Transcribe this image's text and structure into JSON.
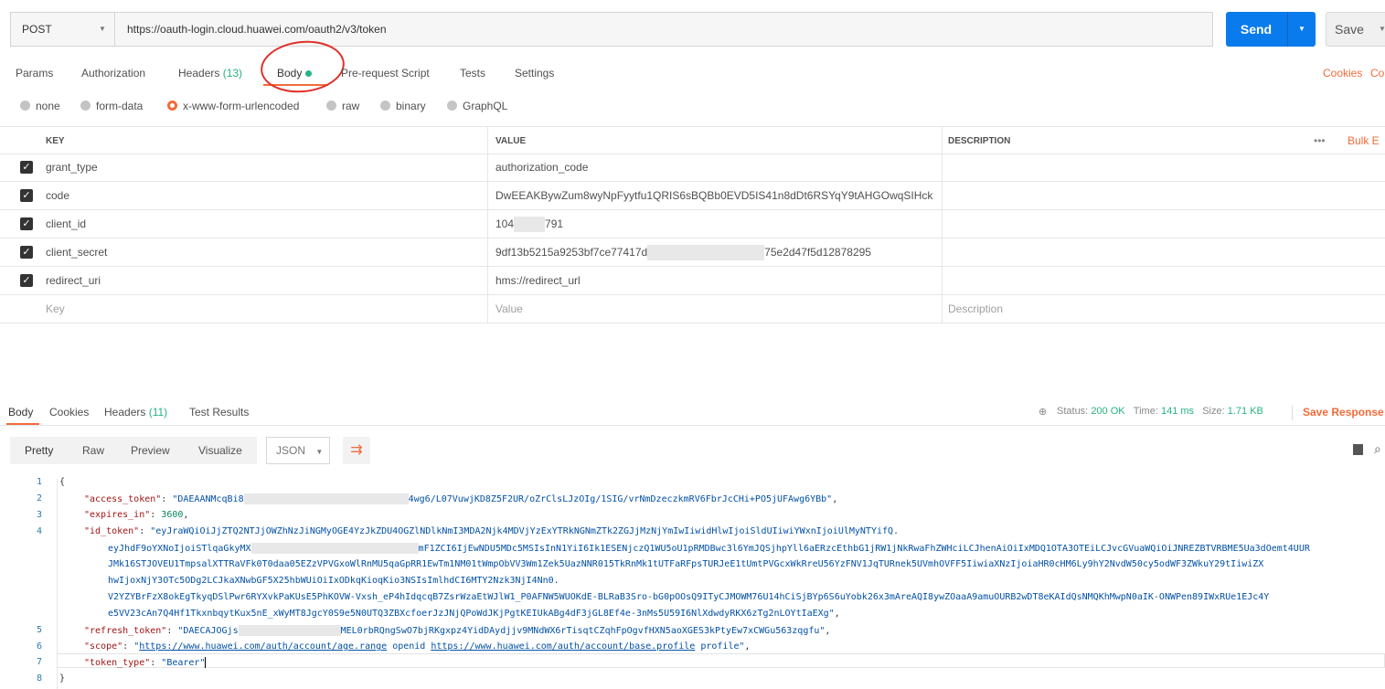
{
  "request": {
    "method": "POST",
    "url": "https://oauth-login.cloud.huawei.com/oauth2/v3/token",
    "send_label": "Send",
    "save_label": "Save"
  },
  "tabs": {
    "params": "Params",
    "authorization": "Authorization",
    "headers": "Headers",
    "headers_count": "(13)",
    "body": "Body",
    "prerequest": "Pre-request Script",
    "tests": "Tests",
    "settings": "Settings",
    "cookies": "Cookies",
    "code": "Co"
  },
  "body_types": {
    "none": "none",
    "form_data": "form-data",
    "urlencoded": "x-www-form-urlencoded",
    "raw": "raw",
    "binary": "binary",
    "graphql": "GraphQL",
    "selected": "x-www-form-urlencoded"
  },
  "params_table": {
    "headers": {
      "key": "KEY",
      "value": "VALUE",
      "description": "DESCRIPTION",
      "more": "•••",
      "bulk": "Bulk E"
    },
    "rows": [
      {
        "key": "grant_type",
        "value": "authorization_code",
        "checked": true
      },
      {
        "key": "code",
        "value": "DwEEAKBywZum8wyNpFyytfu1QRIS6sBQBb0EVD5IS41n8dDt6RSYqY9tAHGOwqSIHck",
        "checked": true
      },
      {
        "key": "client_id",
        "value_a": "104",
        "value_b": "791",
        "checked": true
      },
      {
        "key": "client_secret",
        "value_a": "9df13b5215a9253bf7ce77417d",
        "value_b": "75e2d47f5d12878295",
        "checked": true
      },
      {
        "key": "redirect_uri",
        "value": "hms://redirect_url",
        "checked": true
      }
    ],
    "placeholder": {
      "key": "Key",
      "value": "Value",
      "description": "Description"
    }
  },
  "response": {
    "tabs": {
      "body": "Body",
      "cookies": "Cookies",
      "headers": "Headers",
      "headers_count": "(11)",
      "test_results": "Test Results"
    },
    "status_label": "Status:",
    "status": "200 OK",
    "time_label": "Time:",
    "time": "141 ms",
    "size_label": "Size:",
    "size": "1.71 KB",
    "save_response": "Save Response",
    "view_modes": {
      "pretty": "Pretty",
      "raw": "Raw",
      "preview": "Preview",
      "visualize": "Visualize",
      "format": "JSON"
    }
  },
  "code": {
    "line_numbers": [
      "1",
      "2",
      "3",
      "4",
      "5",
      "6",
      "7",
      "8"
    ],
    "l1": "{",
    "access_key": "\"access_token\"",
    "access_a": "\"DAEAANMcqBi8",
    "access_b": "4wg6/L07VuwjKD8Z5F2UR/oZrClsLJzOIg/1SIG/vrNmDzeczkmRV6FbrJcCHi+PO5jUFAwg6YBb\"",
    "expires_key": "\"expires_in\"",
    "expires_val": "3600",
    "id_key": "\"id_token\"",
    "id_l1": "\"eyJraWQiOiJjZTQ2NTJjOWZhNzJiNGMyOGE4YzJkZDU4OGZlNDlkNmI3MDA2Njk4MDVjYzExYTRkNGNmZTk2ZGJjMzNjYmIwIiwidHlwIjoiSldUIiwiYWxnIjoiUlMyNTYifQ.",
    "id_l2a": "eyJhdF9oYXNoIjoiSTlqaGkyMX",
    "id_l2b": "mF1ZCI6IjEwNDU5MDc5MSIsInN1YiI6Ik1ESENjczQ1WU5oU1pRMDBwc3l6YmJQSjhpYll6aERzcEthbG1jRW1jNkRwaFhZWHciLCJhenAiOiIxMDQ1OTA3OTEiLCJvcGVuaWQiOiJNREZBTVRBME5Ua3dOemt4UUR",
    "id_l3": "JMk16STJOVEU1TmpsalXTTRaVFk0T0daa05EZzVPVGxoWlRnMU5qaGpRR1EwTm1NM01tWmpObVV3Wm1Zek5UazNNR015TkRnMk1tUTFaRFpsTURJeE1tUmtPVGcxWkRreU56YzFNV1JqTURnek5UVmhOVFF5IiwiaXNzIjoiaHR0cHM6Ly9hY2NvdW50cy5odWF3ZWkuY29tIiwiZX",
    "id_l4": "hwIjoxNjY3OTc5ODg2LCJkaXNwbGF5X25hbWUiOiIxODkqKioqKio3NSIsImlhdCI6MTY2Nzk3NjI4Nn0.",
    "id_l5": "V2YZYBrFzX8okEgTkyqDSlPwr6RYXvkPaKUsE5PhKOVW-Vxsh_eP4hIdqcqB7ZsrWzaEtWJlW1_P0AFNW5WUOKdE-BLRaB3Sro-bG0pOOsQ9ITyCJMOWM76U14hCiSjBYp6S6uYobk26x3mAreAQI8ywZOaaA9amuOURB2wDT8eKAIdQsNMQKhMwpN0aIK-ONWPen89IWxRUe1EJc4Y",
    "id_l6": "e5VV23cAn7Q4Hf1TkxnbqytKux5nE_xWyMT8JgcY0S9e5N0UTQ3ZBXcfoerJzJNjQPoWdJKjPgtKEIUkABg4dF3jGL8Ef4e-3nMs5U59I6NlXdwdyRKX6zTg2nLOYtIaEXg\"",
    "refresh_key": "\"refresh_token\"",
    "refresh_a": "\"DAECAJOGjs",
    "refresh_b": "MEL0rbRQngSwO7bjRKgxpz4YidDAydjjv9MNdWX6rTisqtCZqhFpOgvfHXN5aoXGES3kPtyEw7xCWGu563zqgfu\"",
    "scope_key": "\"scope\"",
    "scope_q": "\"",
    "scope_u1": "https://www.huawei.com/auth/account/age.range",
    "scope_mid": " openid ",
    "scope_u2": "https://www.huawei.com/auth/account/base.profile",
    "scope_end": " profile\"",
    "type_key": "\"token_type\"",
    "type_val": "\"Bearer\"",
    "l8": "}"
  },
  "colors": {
    "accent": "#f26b3a",
    "send": "#097bed",
    "success": "#26b47f"
  }
}
